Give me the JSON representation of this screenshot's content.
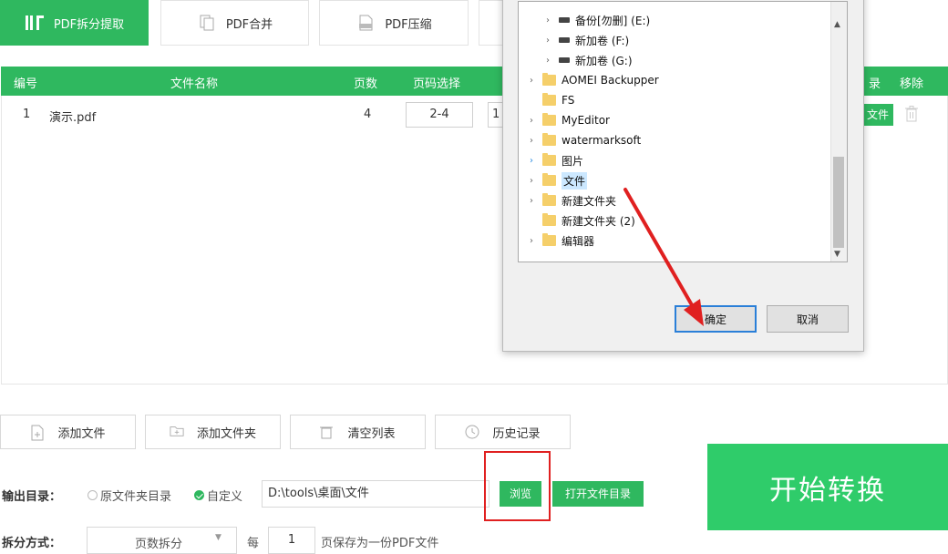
{
  "tabs": [
    {
      "label": "PDF拆分提取",
      "icon": "split-icon",
      "active": true
    },
    {
      "label": "PDF合并",
      "icon": "merge-icon"
    },
    {
      "label": "PDF压缩",
      "icon": "compress-icon"
    }
  ],
  "table": {
    "headers": {
      "index": "编号",
      "filename": "文件名称",
      "pages": "页数",
      "page_select": "页码选择",
      "dir": "录",
      "remove": "移除"
    },
    "rows": [
      {
        "index": "1",
        "filename": "演示.pdf",
        "pages": "4",
        "page_range": "2-4",
        "open_label": "文件"
      }
    ]
  },
  "actions": {
    "add_file": "添加文件",
    "add_folder": "添加文件夹",
    "clear_list": "清空列表",
    "history": "历史记录"
  },
  "output": {
    "label": "输出目录：",
    "option_original": "原文件夹目录",
    "option_custom": "自定义",
    "path": "D:\\tools\\桌面\\文件",
    "browse": "浏览",
    "open_dir": "打开文件目录"
  },
  "split": {
    "label": "拆分方式：",
    "mode": "页数拆分",
    "per": "每",
    "count": "1",
    "suffix": "页保存为一份PDF文件"
  },
  "start_button": "开始转换",
  "dialog": {
    "tree": [
      {
        "label": "备份[勿删] (E:)",
        "type": "drive"
      },
      {
        "label": "新加卷 (F:)",
        "type": "drive"
      },
      {
        "label": "新加卷 (G:)",
        "type": "drive"
      },
      {
        "label": "AOMEI Backupper",
        "type": "folder"
      },
      {
        "label": "FS",
        "type": "folder"
      },
      {
        "label": "MyEditor",
        "type": "folder"
      },
      {
        "label": "watermarksoft",
        "type": "folder"
      },
      {
        "label": "图片",
        "type": "folder"
      },
      {
        "label": "文件",
        "type": "folder",
        "selected": true
      },
      {
        "label": "新建文件夹",
        "type": "folder"
      },
      {
        "label": "新建文件夹 (2)",
        "type": "folder"
      },
      {
        "label": "编辑器",
        "type": "folder"
      }
    ],
    "ok": "确定",
    "cancel": "取消"
  },
  "colors": {
    "accent": "#2fb85f",
    "start": "#2fcc6a",
    "highlight": "#e02020"
  }
}
